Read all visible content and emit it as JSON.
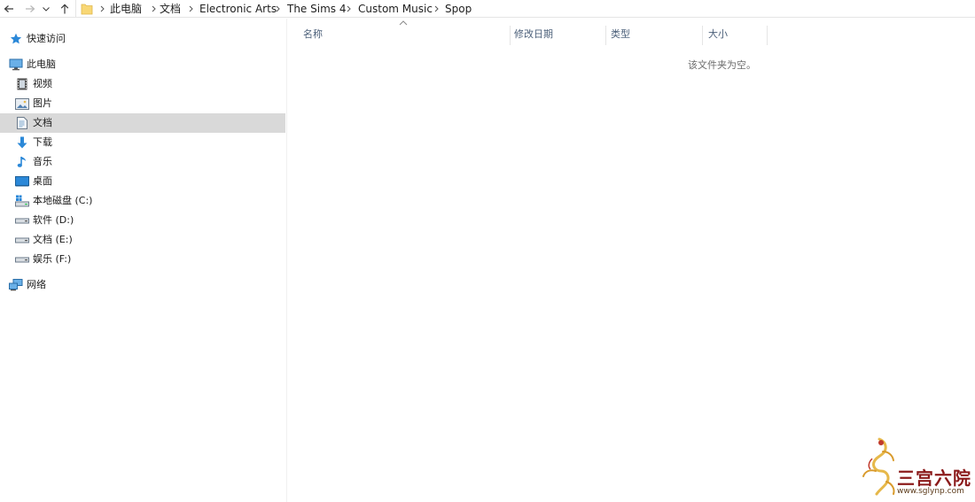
{
  "breadcrumb": [
    "此电脑",
    "文档",
    "Electronic Arts",
    "The Sims 4",
    "Custom Music",
    "Spop"
  ],
  "nav": {
    "quick_access": "快速访问",
    "this_pc": "此电脑",
    "items": [
      {
        "label": "视频",
        "icon": "video-icon"
      },
      {
        "label": "图片",
        "icon": "pictures-icon"
      },
      {
        "label": "文档",
        "icon": "documents-icon"
      },
      {
        "label": "下载",
        "icon": "download-icon"
      },
      {
        "label": "音乐",
        "icon": "music-icon"
      },
      {
        "label": "桌面",
        "icon": "desktop-icon"
      },
      {
        "label": "本地磁盘 (C:)",
        "icon": "system-drive-icon"
      },
      {
        "label": "软件 (D:)",
        "icon": "drive-icon"
      },
      {
        "label": "文档 (E:)",
        "icon": "drive-icon"
      },
      {
        "label": "娱乐 (F:)",
        "icon": "drive-icon"
      }
    ],
    "selected": "文档",
    "network": "网络"
  },
  "columns": {
    "name": "名称",
    "date": "修改日期",
    "type": "类型",
    "size": "大小"
  },
  "empty_message": "该文件夹为空。",
  "watermark": {
    "title": "三宫六院",
    "url": "www.sglynp.com"
  },
  "colors": {
    "selection": "#d9d9d9",
    "header_text": "#4c607a",
    "folder_yellow": "#f8d775",
    "icon_blue": "#2b88d8",
    "watermark_red": "#8b1a1a"
  }
}
